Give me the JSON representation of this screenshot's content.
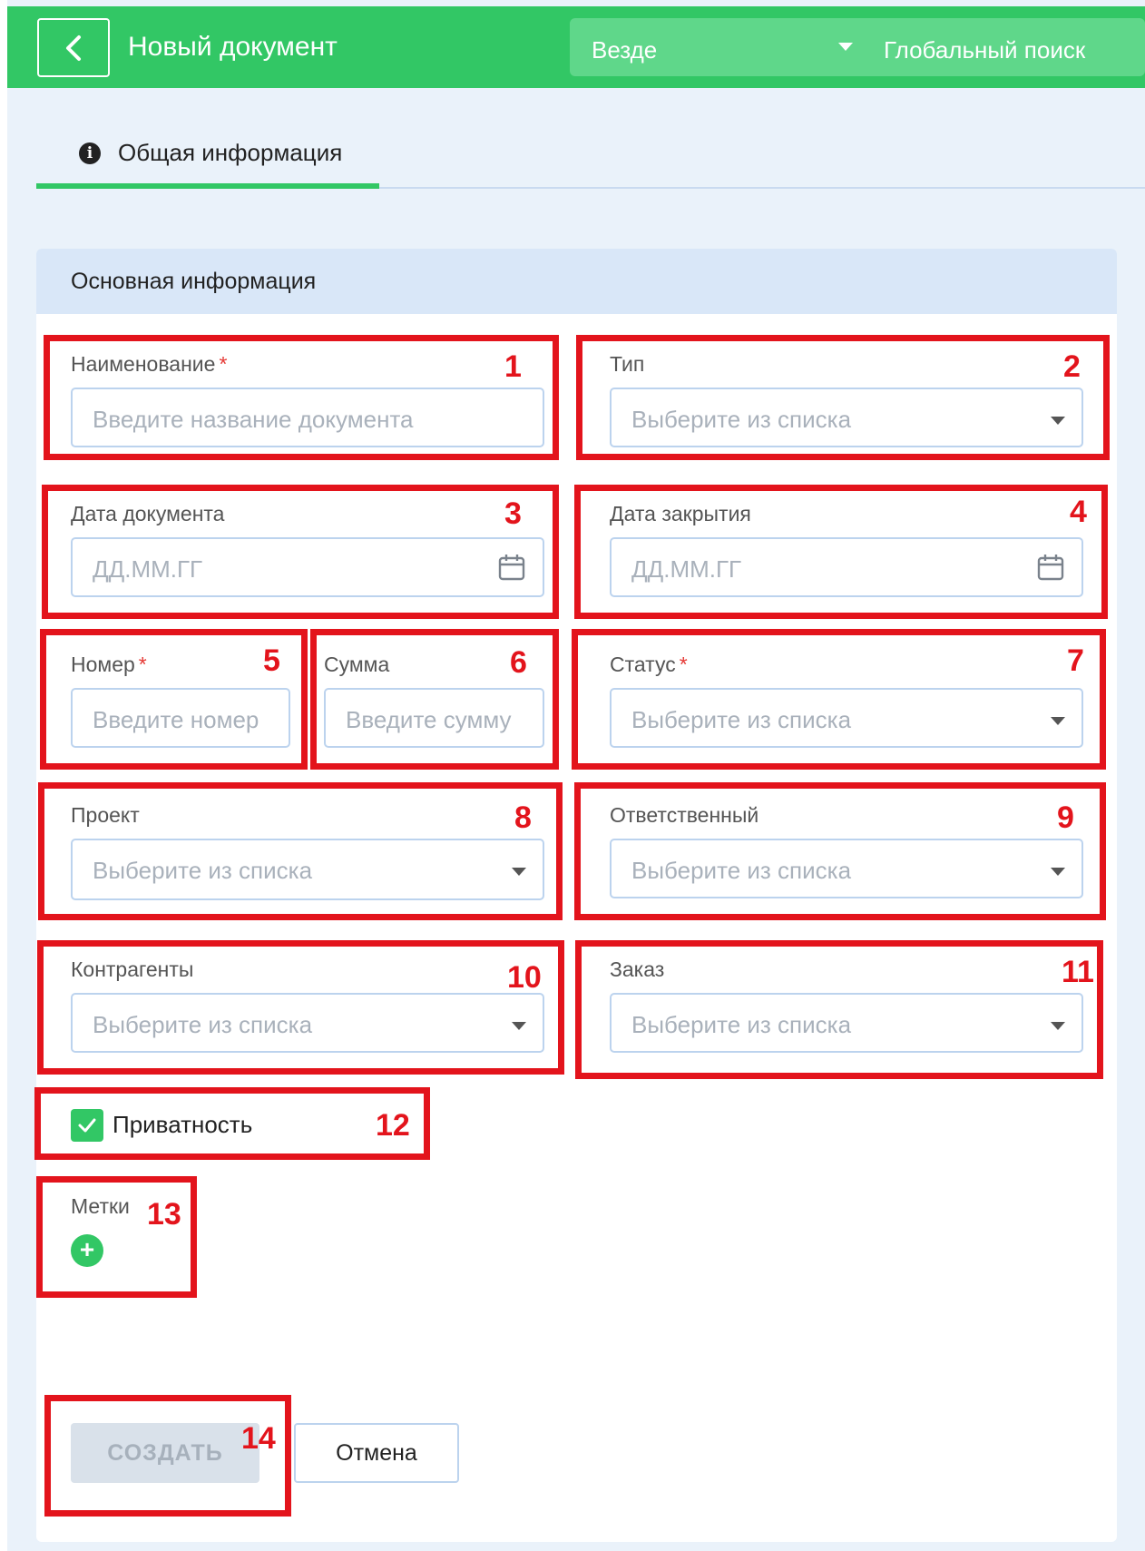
{
  "header": {
    "title": "Новый документ",
    "scope": "Везде",
    "search": "Глобальный поиск"
  },
  "tabs": [
    {
      "label": "Общая информация"
    }
  ],
  "card": {
    "title": "Основная информация"
  },
  "fields": {
    "name": {
      "label": "Наименование",
      "required": "*",
      "placeholder": "Введите название документа"
    },
    "type": {
      "label": "Тип",
      "placeholder": "Выберите из списка"
    },
    "doc_date": {
      "label": "Дата документа",
      "placeholder": "ДД.ММ.ГГ"
    },
    "close_date": {
      "label": "Дата закрытия",
      "placeholder": "ДД.ММ.ГГ"
    },
    "number": {
      "label": "Номер",
      "required": "*",
      "placeholder": "Введите номер"
    },
    "sum": {
      "label": "Сумма",
      "placeholder": "Введите сумму"
    },
    "status": {
      "label": "Статус",
      "required": "*",
      "placeholder": "Выберите из списка"
    },
    "project": {
      "label": "Проект",
      "placeholder": "Выберите из списка"
    },
    "responsible": {
      "label": "Ответственный",
      "placeholder": "Выберите из списка"
    },
    "counterparties": {
      "label": "Контрагенты",
      "placeholder": "Выберите из списка"
    },
    "order": {
      "label": "Заказ",
      "placeholder": "Выберите из списка"
    }
  },
  "privacy": {
    "label": "Приватность",
    "checked": true
  },
  "tags": {
    "label": "Метки",
    "add_icon": "plus-circle-icon"
  },
  "buttons": {
    "create": "СОЗДАТЬ",
    "cancel": "Отмена"
  },
  "annotations": [
    "1",
    "2",
    "3",
    "4",
    "5",
    "6",
    "7",
    "8",
    "9",
    "10",
    "11",
    "12",
    "13",
    "14"
  ],
  "colors": {
    "accent": "#32c765",
    "annotation": "#e3141c",
    "background": "#eaf2fa",
    "card_header": "#d9e7f8"
  }
}
